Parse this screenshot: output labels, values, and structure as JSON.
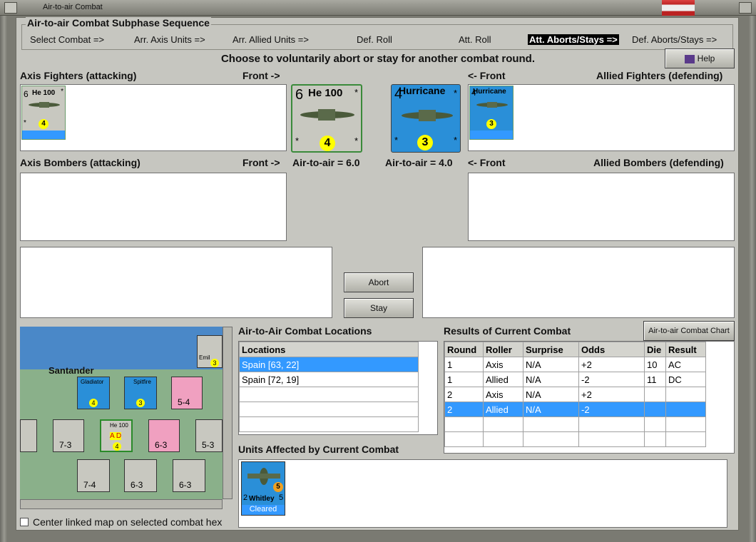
{
  "window": {
    "title": "Air-to-air Combat"
  },
  "sequence": {
    "title": "Air-to-air Combat Subphase Sequence",
    "steps": [
      {
        "label": "Select Combat =>"
      },
      {
        "label": "Arr. Axis Units =>"
      },
      {
        "label": "Arr. Allied Units =>"
      },
      {
        "label": "Def. Roll"
      },
      {
        "label": "Att. Roll"
      },
      {
        "label": "Att. Aborts/Stays =>"
      },
      {
        "label": "Def. Aborts/Stays =>"
      }
    ]
  },
  "prompt": "Choose to voluntarily abort or stay for another combat round.",
  "help_label": "Help",
  "labels": {
    "axis_fighters": "Axis Fighters (attacking)",
    "front_right": "Front ->",
    "front_left": "<- Front",
    "allied_fighters": "Allied Fighters (defending)",
    "axis_bombers": "Axis Bombers (attacking)",
    "allied_bombers": "Allied Bombers (defending)",
    "axis_a2a": "Air-to-air = 6.0",
    "allied_a2a": "Air-to-air = 4.0"
  },
  "axis_fighter": {
    "name": "He 100",
    "strength": "6",
    "range": "4",
    "star": "*"
  },
  "allied_fighter": {
    "name": "Hurricane",
    "strength": "4",
    "range": "3",
    "star": "*"
  },
  "buttons": {
    "abort": "Abort",
    "stay": "Stay",
    "chart": "Air-to-air Combat Chart"
  },
  "locations": {
    "title": "Air-to-Air Combat Locations",
    "header": "Locations",
    "rows": [
      "Spain [63, 22]",
      "Spain [72, 19]"
    ]
  },
  "results": {
    "title": "Results of Current Combat",
    "headers": [
      "Round",
      "Roller",
      "Surprise",
      "Odds",
      "Die",
      "Result"
    ],
    "rows": [
      [
        "1",
        "Axis",
        "N/A",
        "+2",
        "10",
        "AC"
      ],
      [
        "1",
        "Allied",
        "N/A",
        "-2",
        "11",
        "DC"
      ],
      [
        "2",
        "Axis",
        "N/A",
        "+2",
        "",
        ""
      ],
      [
        "2",
        "Allied",
        "N/A",
        "-2",
        "",
        ""
      ]
    ]
  },
  "affected": {
    "title": "Units Affected by Current Combat",
    "unit_name": "Whitley",
    "strength": "2",
    "range": "5",
    "move": "5",
    "status": "Cleared"
  },
  "map": {
    "city": "Santander",
    "units": [
      {
        "name": "Gladiator",
        "n": "4"
      },
      {
        "name": "Spitfire",
        "n": "3"
      },
      {
        "name": "Emil",
        "n": "3"
      },
      {
        "name": "He 100",
        "n": "4"
      }
    ],
    "counters": [
      "5-4",
      "7-3",
      "6-3",
      "7-4",
      "6-3",
      "6-3",
      "5-3"
    ],
    "mark": "A D",
    "top": [
      "2",
      "2",
      "2",
      "3",
      "4",
      "3",
      "3",
      "3",
      "2"
    ]
  },
  "center_checkbox": "Center linked map on selected combat hex",
  "colors": {
    "selected": "#3399ff",
    "allied": "#2a8fd8",
    "axis": "#c8c8c0"
  }
}
